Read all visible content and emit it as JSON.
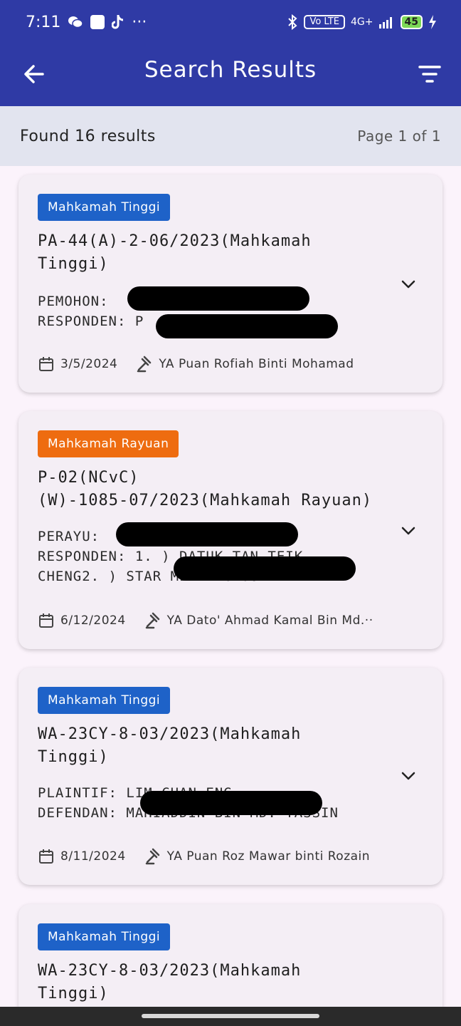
{
  "status_bar": {
    "time": "7:11",
    "more": "···",
    "volte": "Vo LTE",
    "network": "4G+",
    "battery": "45"
  },
  "header": {
    "title": "Search Results"
  },
  "summary": {
    "count_text": "Found 16 results",
    "page_text": "Page 1 of 1"
  },
  "results": [
    {
      "court": "Mahkamah Tinggi",
      "court_color": "#1e62c8",
      "case_no_line1": "PA-44(A)-2-06/2023(Mahkamah",
      "case_no_line2": "Tinggi)",
      "party1": "PEMOHON: ",
      "party2": "RESPONDEN: P",
      "date": "3/5/2024",
      "judge": "YA Puan Rofiah Binti Mohamad"
    },
    {
      "court": "Mahkamah Rayuan",
      "court_color": "#ee6c10",
      "case_no_line1": "P-02(NCvC)",
      "case_no_line2": "(W)-1085-07/2023(Mahkamah Rayuan)",
      "party1": "PERAYU: ",
      "party2": "RESPONDEN: 1. ) DATUK TAN TEIK",
      "party3": "CHENG2. ) STAR MEDIA GROUP BERHAD",
      "date": "6/12/2024",
      "judge": "YA Dato' Ahmad Kamal Bin Md.··"
    },
    {
      "court": "Mahkamah Tinggi",
      "court_color": "#1e62c8",
      "case_no_line1": "WA-23CY-8-03/2023(Mahkamah",
      "case_no_line2": "Tinggi)",
      "party1": "PLAINTIF: LIM CHAN ENG",
      "party2": "DEFENDAN: MAHIADDIN BIN MD. YASSIN",
      "date": "8/11/2024",
      "judge": "YA Puan Roz Mawar binti Rozain"
    },
    {
      "court": "Mahkamah Tinggi",
      "court_color": "#1e62c8",
      "case_no_line1": "WA-23CY-8-03/2023(Mahkamah",
      "case_no_line2": "Tinggi)"
    }
  ],
  "icons": {
    "back": "arrow-back-icon",
    "filter": "filter-icon",
    "expand": "chevron-down-icon",
    "calendar": "calendar-icon",
    "judge": "gavel-icon"
  }
}
